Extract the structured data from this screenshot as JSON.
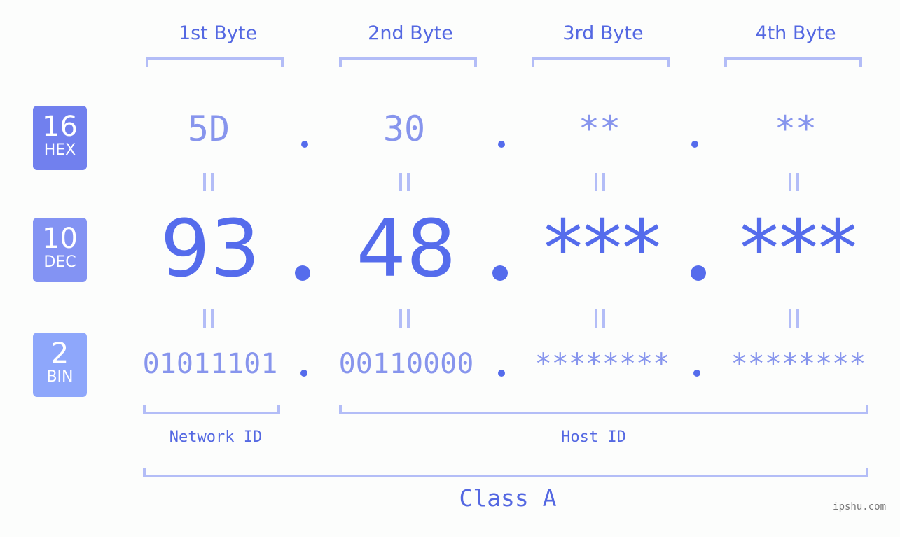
{
  "byte_headers": [
    "1st Byte",
    "2nd Byte",
    "3rd Byte",
    "4th Byte"
  ],
  "badges": [
    {
      "number": "16",
      "label": "HEX",
      "color": "#7180ee"
    },
    {
      "number": "10",
      "label": "DEC",
      "color": "#8393f3"
    },
    {
      "number": "2",
      "label": "BIN",
      "color": "#8ea7fb"
    }
  ],
  "hex": [
    "5D",
    "30",
    "**",
    "**"
  ],
  "dec": [
    "93",
    "48",
    "***",
    "***"
  ],
  "bin": [
    "01011101",
    "00110000",
    "********",
    "********"
  ],
  "separator": ".",
  "labels": {
    "network": "Network ID",
    "host": "Host ID",
    "class": "Class A"
  },
  "watermark": "ipshu.com",
  "colors": {
    "accent": "#556cec",
    "light": "#8795ed",
    "bracket": "#b3bdf7"
  }
}
